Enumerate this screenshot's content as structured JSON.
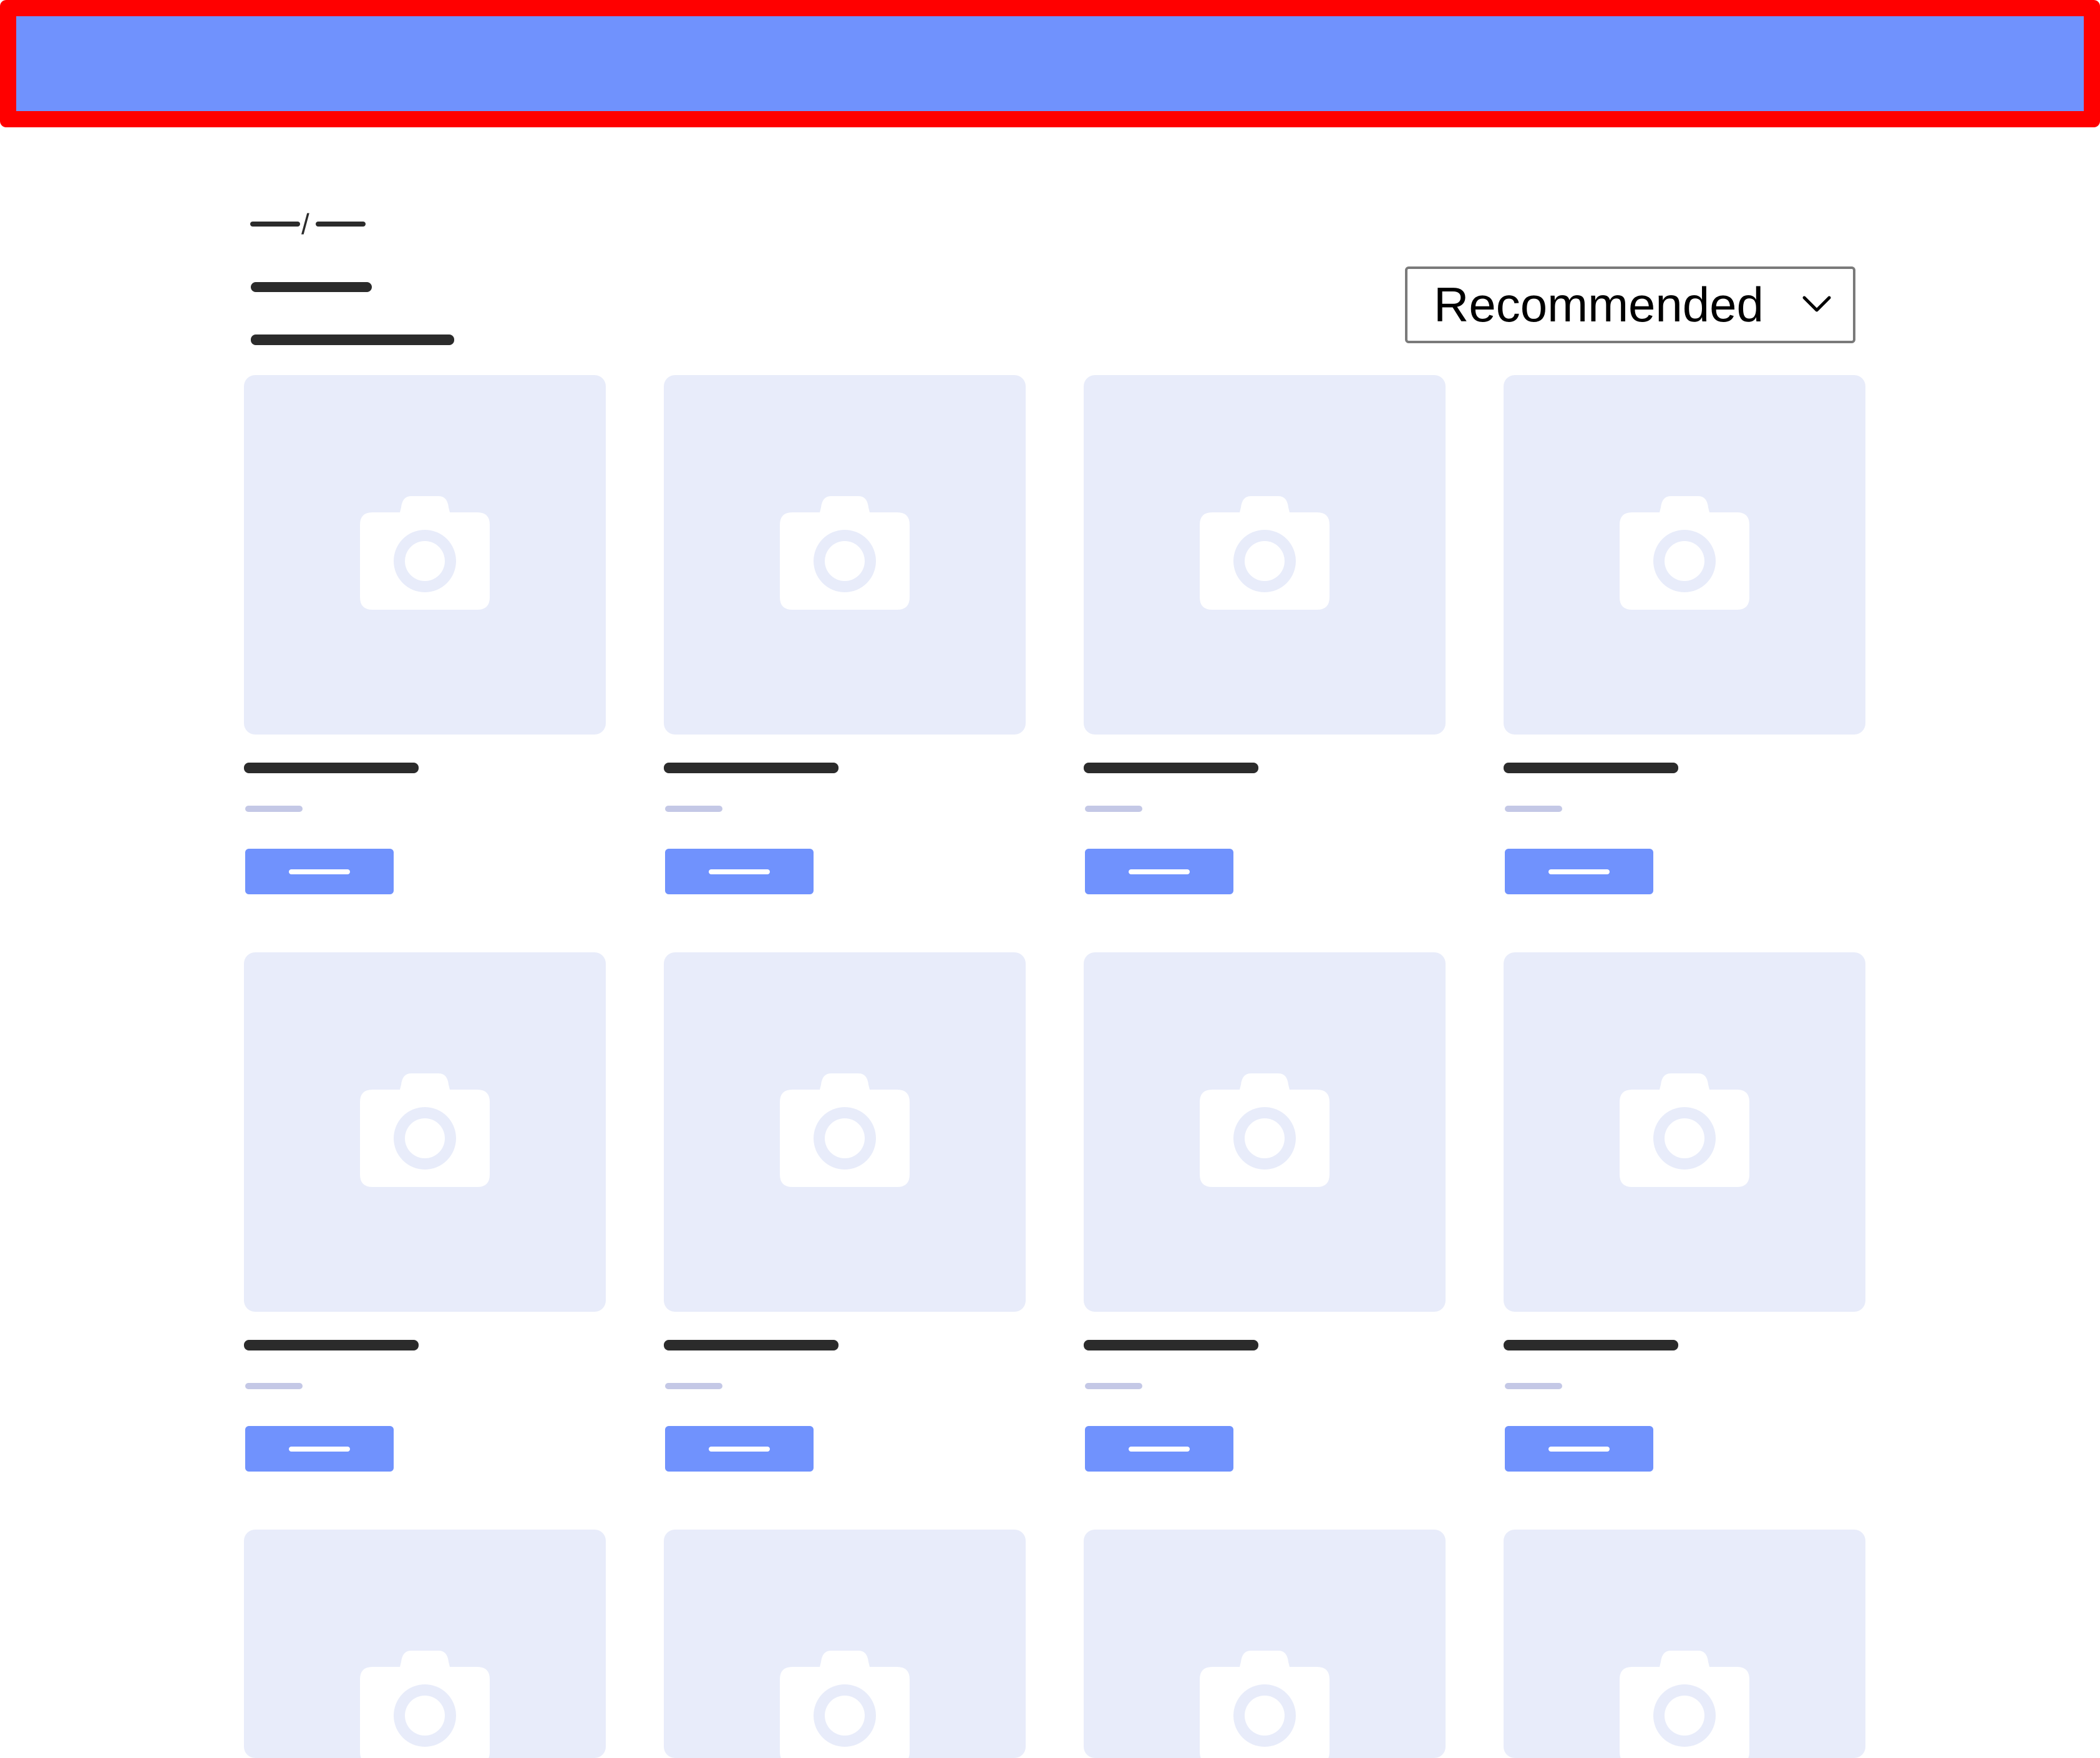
{
  "header": {
    "bar_color": "#7092fd",
    "outline_color": "#ff0000"
  },
  "breadcrumb": {
    "separator": "/"
  },
  "sort": {
    "selected": "Recommended",
    "icon": "chevron-down-icon"
  },
  "grid": {
    "columns": 4,
    "rows_visible": 3,
    "image_icon": "camera-icon",
    "image_bg": "#e8ecfa",
    "button_color": "#7092fd"
  }
}
